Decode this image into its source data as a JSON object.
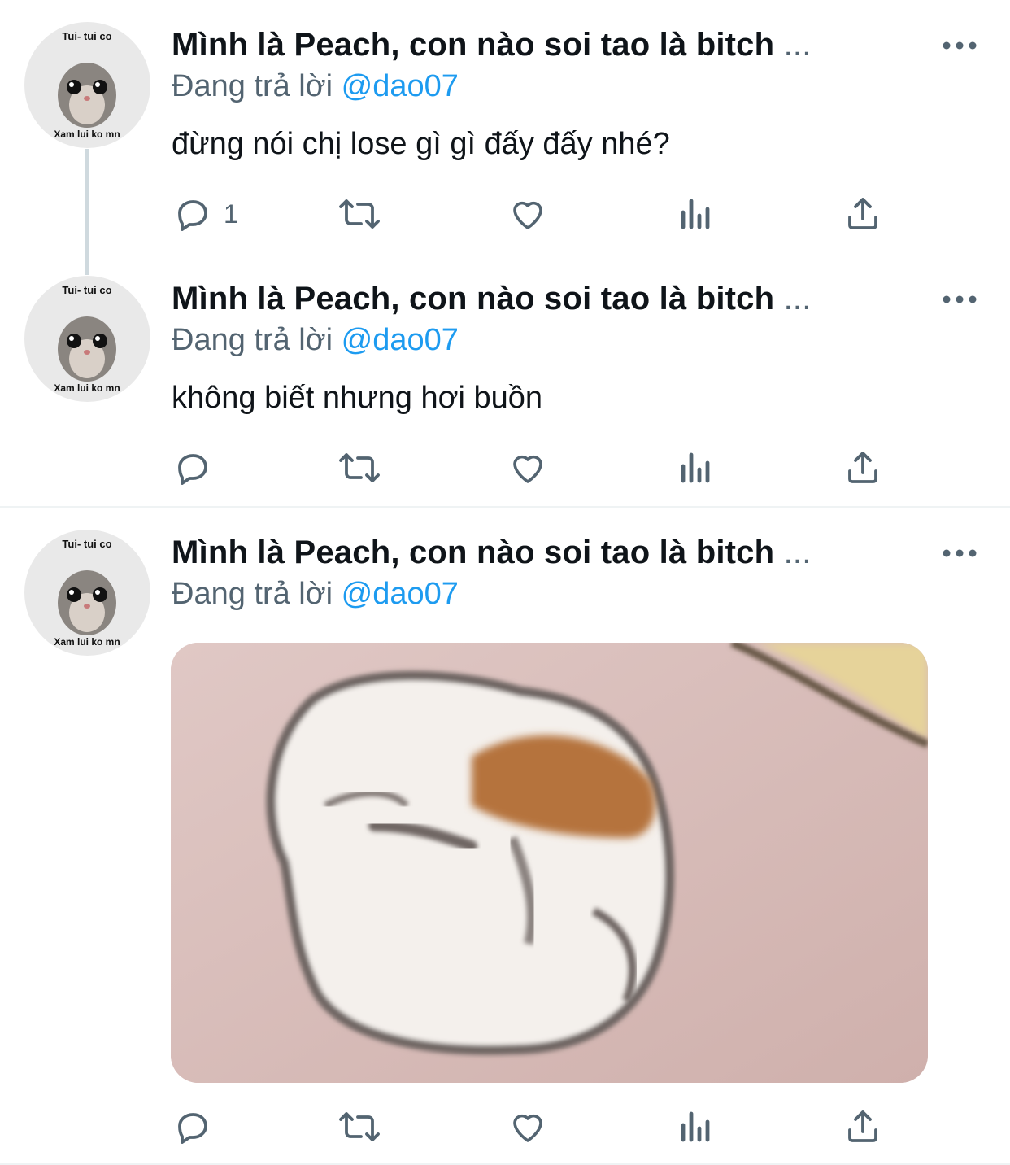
{
  "tweets": [
    {
      "author_name": "Mình là Peach, con nào soi tao là bitch",
      "name_ellipsis": "...",
      "replying_prefix": "Đang trả lời",
      "replying_handle": "@dao07",
      "text": "đừng nói chị lose gì gì đấy đấy nhé?",
      "reply_count": "1",
      "avatar_top_text": "Tui- tui co",
      "avatar_bottom_text": "Xam lui ko mn"
    },
    {
      "author_name": "Mình là Peach, con nào soi tao là bitch",
      "name_ellipsis": "...",
      "replying_prefix": "Đang trả lời",
      "replying_handle": "@dao07",
      "text": "không biết nhưng hơi buồn",
      "reply_count": "",
      "avatar_top_text": "Tui- tui co",
      "avatar_bottom_text": "Xam lui ko mn"
    },
    {
      "author_name": "Mình là Peach, con nào soi tao là bitch",
      "name_ellipsis": "...",
      "replying_prefix": "Đang trả lời",
      "replying_handle": "@dao07",
      "text": "",
      "reply_count": "",
      "avatar_top_text": "Tui- tui co",
      "avatar_bottom_text": "Xam lui ko mn"
    }
  ],
  "icons": {
    "more": "more-horizontal-icon",
    "reply": "reply-bubble-icon",
    "retweet": "retweet-icon",
    "like": "heart-icon",
    "views": "views-bar-chart-icon",
    "share": "share-upload-icon"
  },
  "colors": {
    "link": "#1d9bf0",
    "secondary_text": "#536471",
    "primary_text": "#0f1419",
    "divider": "#eff3f4"
  }
}
